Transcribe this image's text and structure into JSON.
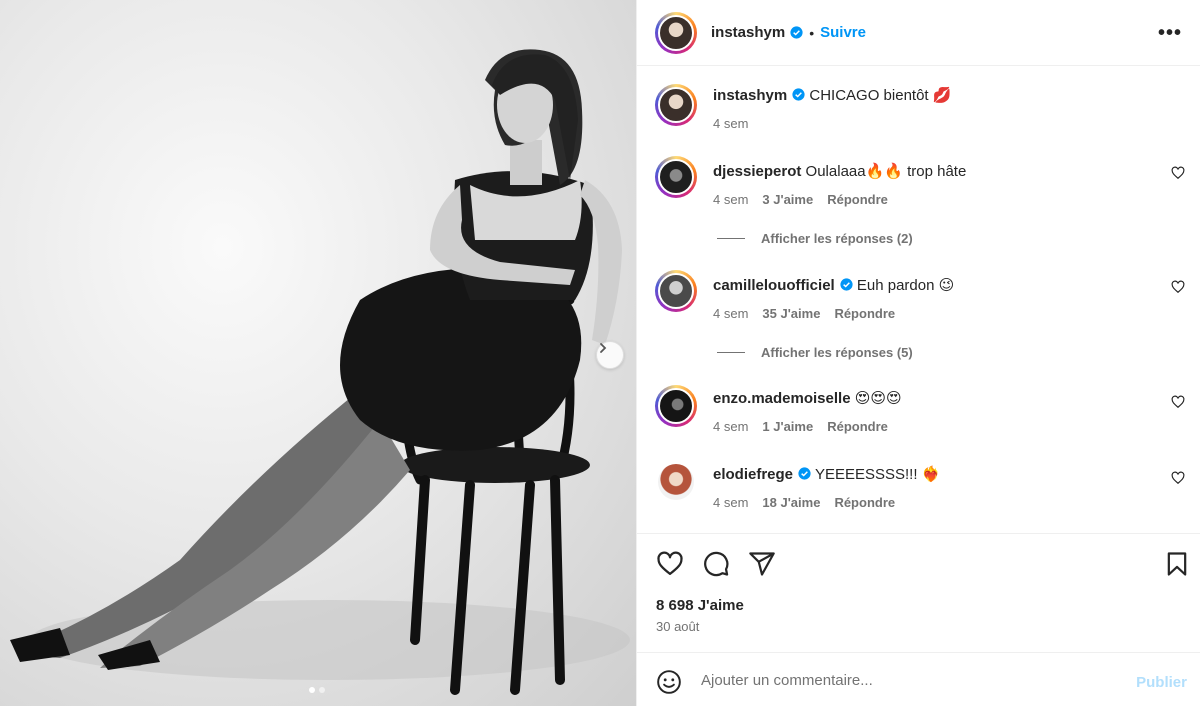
{
  "post": {
    "author": "instashym",
    "follow_label": "Suivre",
    "separator": "•",
    "more_label": "•••",
    "caption": "CHICAGO bientôt 💋",
    "caption_time": "4 sem",
    "likes": "8 698 J'aime",
    "date": "30 août"
  },
  "comments": [
    {
      "user": "djessieperot",
      "verified": false,
      "text": "Oulalaaa🔥🔥 trop hâte",
      "time": "4 sem",
      "likes": "3 J'aime",
      "reply": "Répondre",
      "replies": "Afficher les réponses (2)"
    },
    {
      "user": "camillelouofficiel",
      "verified": true,
      "text": "Euh pardon 😉",
      "time": "4 sem",
      "likes": "35 J'aime",
      "reply": "Répondre",
      "replies": "Afficher les réponses (5)"
    },
    {
      "user": "enzo.mademoiselle",
      "verified": false,
      "text": "😍😍😍",
      "time": "4 sem",
      "likes": "1 J'aime",
      "reply": "Répondre"
    },
    {
      "user": "elodiefrege",
      "verified": true,
      "text": "YEEEESSSS!!! ❤️‍🔥",
      "time": "4 sem",
      "likes": "18 J'aime",
      "reply": "Répondre"
    }
  ],
  "composer": {
    "placeholder": "Ajouter un commentaire...",
    "publish_label": "Publier"
  },
  "carousel": {
    "slides": 2,
    "active": 1
  },
  "icons": {
    "more": "more-horizontal-icon",
    "like": "heart-icon",
    "comment": "comment-icon",
    "share": "share-icon",
    "save": "bookmark-icon",
    "emoji": "emoji-icon",
    "verified": "verified-badge-icon",
    "next": "chevron-right-icon"
  },
  "colors": {
    "link": "#0095f6",
    "publish_disabled": "#b2dffc",
    "muted": "#737373",
    "verified": "#0095f6"
  }
}
